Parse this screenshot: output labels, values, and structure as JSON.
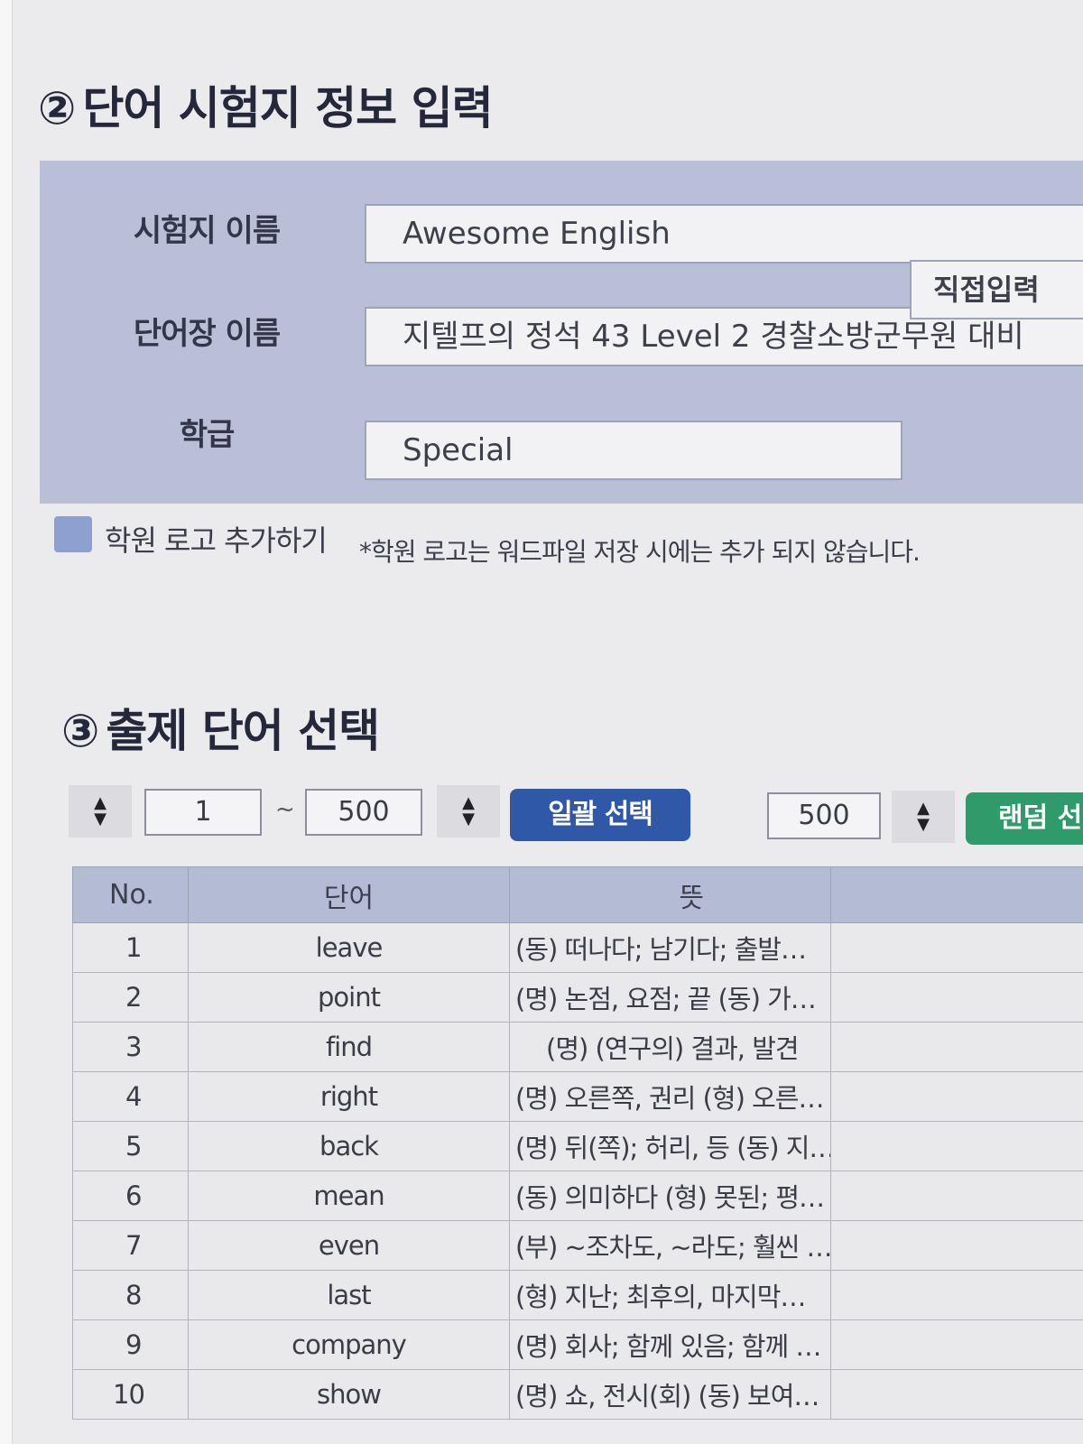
{
  "section2": {
    "number": "②",
    "title": "단어 시험지 정보 입력"
  },
  "form": {
    "exam_name_label": "시험지 이름",
    "exam_name_value": "Awesome English",
    "wordbook_label": "단어장 이름",
    "wordbook_value": "지텔프의 정석 43 Level 2 경찰소방군무원 대비",
    "grade_label": "학급",
    "grade_value": "Special",
    "direct_input_label": "직접입력"
  },
  "logo": {
    "label": "학원 로고 추가하기",
    "note": "*학원 로고는 워드파일 저장 시에는 추가 되지 않습니다."
  },
  "section3": {
    "number": "③",
    "title": "출제 단어 선택"
  },
  "controls": {
    "range_start": "1",
    "range_tilde": "~",
    "range_end": "500",
    "bulk_select_label": "일괄 선택",
    "random_count": "500",
    "random_label": "랜덤 선"
  },
  "table": {
    "headers": {
      "no": "No.",
      "word": "단어",
      "meaning": "뜻"
    },
    "rows": [
      {
        "no": "1",
        "word": "leave",
        "meaning": "(동) 떠나다; 남기다; 출발…"
      },
      {
        "no": "2",
        "word": "point",
        "meaning": "(명) 논점, 요점; 끝 (동) 가…"
      },
      {
        "no": "3",
        "word": "find",
        "meaning": "(명) (연구의) 결과, 발견"
      },
      {
        "no": "4",
        "word": "right",
        "meaning": "(명) 오른쪽, 권리 (형) 오른…"
      },
      {
        "no": "5",
        "word": "back",
        "meaning": "(명) 뒤(쪽); 허리, 등 (동) 지…"
      },
      {
        "no": "6",
        "word": "mean",
        "meaning": "(동) 의미하다 (형) 못된; 평…"
      },
      {
        "no": "7",
        "word": "even",
        "meaning": "(부) ~조차도, ~라도; 훨씬 …"
      },
      {
        "no": "8",
        "word": "last",
        "meaning": "(형) 지난; 최후의, 마지막…"
      },
      {
        "no": "9",
        "word": "company",
        "meaning": "(명) 회사; 함께 있음; 함께 …"
      },
      {
        "no": "10",
        "word": "show",
        "meaning": "(명) 쇼, 전시(회) (동) 보여…"
      }
    ]
  }
}
